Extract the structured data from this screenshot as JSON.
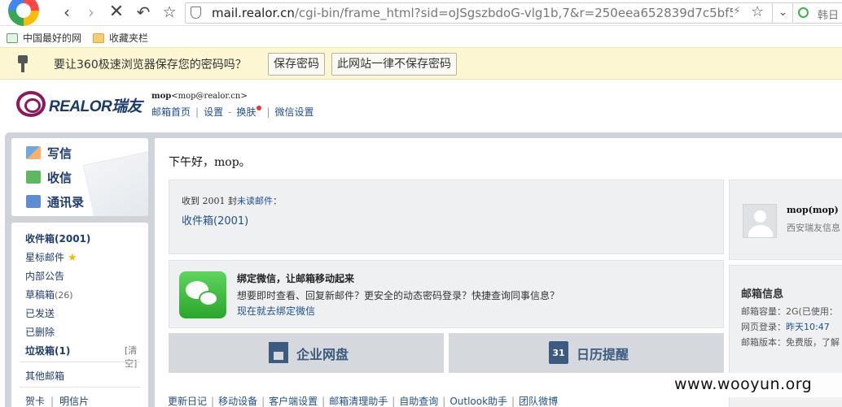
{
  "browser": {
    "url_host": "mail.realor.cn",
    "url_path": "/cgi-bin/frame_html?sid=oJSgszbdoG-vlg1b,7&r=250eea652839d7c5bf5l",
    "search_text": "韩日",
    "bookmarks": [
      "中国最好的网",
      "收藏夹栏"
    ],
    "icons": [
      "back-icon",
      "forward-icon",
      "stop-icon",
      "undo-icon",
      "star-icon",
      "shield-icon",
      "bolt-icon",
      "chevron-down-icon",
      "search-icon"
    ]
  },
  "password_bar": {
    "message": "要让360极速浏览器保存您的密码吗？",
    "save_label": "保存密码",
    "never_label": "此网站一律不保存密码"
  },
  "header": {
    "brand": "REALOR瑞友",
    "username": "mop",
    "email": "<mop@realor.cn>",
    "nav": [
      "邮箱首页",
      "设置",
      "换肤",
      "微信设置"
    ]
  },
  "sidebar": {
    "actions": [
      "写信",
      "收信",
      "通讯录"
    ],
    "folders": {
      "inbox": "收件箱",
      "inbox_count": "(2001)",
      "starred": "星标邮件",
      "notice": "内部公告",
      "drafts": "草稿箱",
      "drafts_count": "(26)",
      "sent": "已发送",
      "deleted": "已删除",
      "spam": "垃圾箱",
      "spam_count": "(1)",
      "clear": "[清空]",
      "other": "其他邮箱",
      "cards": "贺卡",
      "postcards": "明信片"
    }
  },
  "main": {
    "greeting": "下午好，mop。",
    "received_prefix": "收到 2001 封",
    "received_link": "未读邮件",
    "received_suffix": "：",
    "inbox_link": "收件箱(2001)",
    "wechat_title": "绑定微信，让邮箱移动起来",
    "wechat_desc": "想要即时查看、回复新邮件？更安全的动态密码登录？快捷查询同事信息？",
    "wechat_link": "现在就去绑定微信",
    "tile_disk": "企业网盘",
    "tile_calendar": "日历提醒",
    "calendar_day": "31",
    "bottom_links": [
      "更新日记",
      "移动设备",
      "客户端设置",
      "邮箱清理助手",
      "自助查询",
      "Outlook助手",
      "团队微博"
    ]
  },
  "profile": {
    "name": "mop(mop)",
    "org": "西安瑞友信息",
    "mailbox_title": "邮箱信息",
    "capacity_label": "邮箱容量：",
    "capacity_value": "2G(已使用：",
    "login_label": "网页登录：",
    "login_value": "昨天10:47",
    "version_label": "邮箱版本：",
    "version_value": "免费版，了解"
  },
  "watermark": "www.wooyun.org",
  "colors": {
    "link": "#1f4f8b",
    "frame": "#cfd4da",
    "pwbar": "#fdf6d3",
    "brand": "#8b1a5a"
  }
}
